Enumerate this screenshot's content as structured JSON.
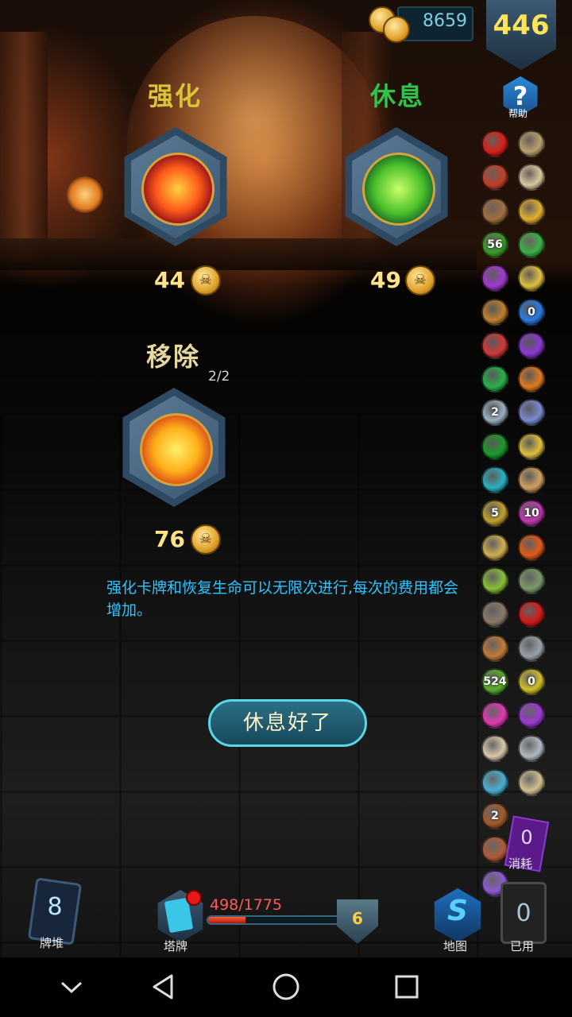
{
  "top": {
    "gold": "8659",
    "hp": "446",
    "help_label": "帮助",
    "help_glyph": "?"
  },
  "options": [
    {
      "title": "强化",
      "cost": "44",
      "title_color": "#d9c43a"
    },
    {
      "title": "休息",
      "cost": "49",
      "title_color": "#2fc44a"
    },
    {
      "title": "移除",
      "cost": "76",
      "title_color": "#e6d6a0",
      "uses": "2/2"
    }
  ],
  "description": "强化卡牌和恢复生命可以无限次进行,每次的费用都会增加。",
  "rest_button": "休息好了",
  "relics": [
    {
      "name": "apple-icon",
      "label": "",
      "color": "#d8201a"
    },
    {
      "name": "sack-icon",
      "label": "",
      "color": "#b8a070"
    },
    {
      "name": "wine-glass-icon",
      "label": "",
      "color": "#c0402a"
    },
    {
      "name": "skull-icon",
      "label": "",
      "color": "#d8c8a0"
    },
    {
      "name": "shovel-icon",
      "label": "",
      "color": "#a07040"
    },
    {
      "name": "golden-emblem-icon",
      "label": "",
      "color": "#e0b030"
    },
    {
      "name": "green-rune-icon",
      "label": "56",
      "color": "#3a9a2a"
    },
    {
      "name": "green-claw-icon",
      "label": "",
      "color": "#3ab04a"
    },
    {
      "name": "purple-wand-icon",
      "label": "",
      "color": "#a03ad0"
    },
    {
      "name": "gold-rune-icon",
      "label": "",
      "color": "#e0c040"
    },
    {
      "name": "tome-icon",
      "label": "",
      "color": "#c08030"
    },
    {
      "name": "blue-orb-icon",
      "label": "0",
      "color": "#2a7ae0"
    },
    {
      "name": "sock-icon",
      "label": "",
      "color": "#d03a3a"
    },
    {
      "name": "purple-flame-icon",
      "label": "",
      "color": "#8a3ad0"
    },
    {
      "name": "green-sigil-icon",
      "label": "",
      "color": "#2ab04a"
    },
    {
      "name": "lantern-icon",
      "label": "",
      "color": "#e07a20"
    },
    {
      "name": "feather-icon",
      "label": "2",
      "color": "#9ab0c0"
    },
    {
      "name": "crystal-ball-icon",
      "label": "",
      "color": "#7a8ad0"
    },
    {
      "name": "green-gem-icon",
      "label": "",
      "color": "#1a9a2a"
    },
    {
      "name": "yellow-sigil-icon",
      "label": "",
      "color": "#e0c040"
    },
    {
      "name": "cyan-sigil-icon",
      "label": "",
      "color": "#2ab0c0"
    },
    {
      "name": "scroll-icon",
      "label": "",
      "color": "#d0a060"
    },
    {
      "name": "dagger-icon",
      "label": "5",
      "color": "#c0a030"
    },
    {
      "name": "pink-burst-icon",
      "label": "10",
      "color": "#c03ab0"
    },
    {
      "name": "map-pick-icon",
      "label": "",
      "color": "#d0b050"
    },
    {
      "name": "meteor-icon",
      "label": "",
      "color": "#e05a1a"
    },
    {
      "name": "leaves-icon",
      "label": "",
      "color": "#8ac03a"
    },
    {
      "name": "turtle-icon",
      "label": "",
      "color": "#7a9a6a"
    },
    {
      "name": "pickaxe-icon",
      "label": "",
      "color": "#8a7a6a"
    },
    {
      "name": "red-envelope-icon",
      "label": "",
      "color": "#d01a1a"
    },
    {
      "name": "horn-icon",
      "label": "",
      "color": "#c07a3a"
    },
    {
      "name": "hammer-icon",
      "label": "",
      "color": "#9aa0aa"
    },
    {
      "name": "green-coil-icon",
      "label": "524",
      "color": "#5ab02a"
    },
    {
      "name": "yellow-swirl-icon",
      "label": "0",
      "color": "#d0c02a"
    },
    {
      "name": "gift-icon",
      "label": "",
      "color": "#e03ab0"
    },
    {
      "name": "purple-sigil-icon",
      "label": "",
      "color": "#9a3ad0"
    },
    {
      "name": "bandage-icon",
      "label": "",
      "color": "#d8c8a8"
    },
    {
      "name": "vial-icon",
      "label": "",
      "color": "#b0b8c0"
    },
    {
      "name": "fountain-icon",
      "label": "",
      "color": "#4ab0d0"
    },
    {
      "name": "bowl-icon",
      "label": "",
      "color": "#d0c090"
    },
    {
      "name": "pouch-icon",
      "label": "2",
      "color": "#a05a2a"
    },
    {
      "name": "blank-slot-icon",
      "label": "",
      "color": "#000000"
    },
    {
      "name": "boot-icon",
      "label": "",
      "color": "#b05a3a"
    },
    {
      "name": "blank-slot-icon",
      "label": "",
      "color": "#000000"
    },
    {
      "name": "spirit-icon",
      "label": "",
      "color": "#8a5ad0"
    },
    {
      "name": "blank-slot-icon",
      "label": "",
      "color": "#000000"
    }
  ],
  "bottom": {
    "deck_count": "8",
    "deck_label": "牌堆",
    "tower_label": "塔牌",
    "hp_text": "498/1775",
    "hp_fraction": 0.2806,
    "block": "6",
    "map_label": "地图",
    "map_glyph": "S",
    "exhaust_count": "0",
    "exhaust_label": "消耗",
    "discard_count": "0",
    "discard_label": "已用"
  }
}
